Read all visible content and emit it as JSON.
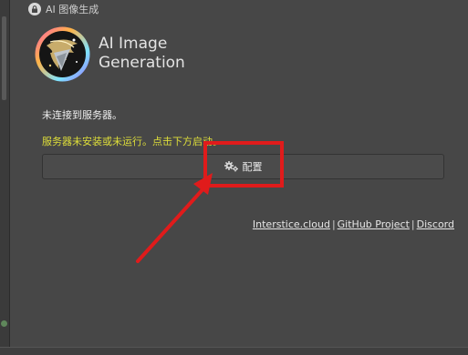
{
  "panel": {
    "title": "AI 图像生成",
    "icon": "lock-icon"
  },
  "header": {
    "title_line1": "AI Image",
    "title_line2": "Generation",
    "logo": "ai-diffusion-logo"
  },
  "status": {
    "connection": "未连接到服务器。",
    "warning": "服务器未安装或未运行。点击下方启动。"
  },
  "config_button": {
    "label": "配置",
    "icon": "gear-icon"
  },
  "links": [
    {
      "label": "Interstice.cloud"
    },
    {
      "label": "GitHub Project"
    },
    {
      "label": "Discord"
    }
  ],
  "separator": "|",
  "colors": {
    "background": "#474747",
    "warning": "#dede3a",
    "annotation": "#e01b1b"
  }
}
